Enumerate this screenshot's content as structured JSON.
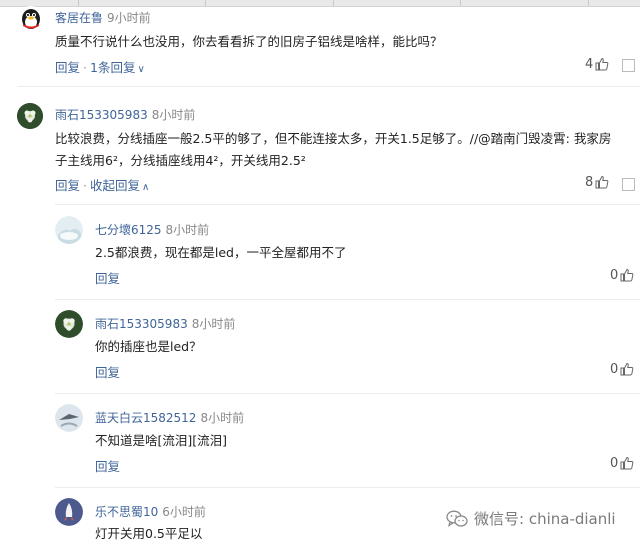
{
  "comments": [
    {
      "user": "客居在鲁",
      "time": "9小时前",
      "text": "质量不行说什么也没用，你去看看拆了的旧房子铝线是啥样，能比吗？",
      "reply": "回复",
      "thread": "1条回复",
      "likes": "4"
    },
    {
      "user": "雨石153305983",
      "time": "8小时前",
      "text_line1": "比较浪费，分线插座一般2.5平的够了，但不能连接太多，开关1.5足够了。//@踏南门毁凌霄: 我家房",
      "text_line2": "子主线用6²，分线插座线用4²，开关线用2.5²",
      "reply": "回复",
      "thread": "收起回复",
      "likes": "8"
    }
  ],
  "replies": [
    {
      "user": "七分壞6125",
      "time": "8小时前",
      "text": "2.5都浪费，现在都是led，一平全屋都用不了",
      "reply": "回复",
      "likes": "0"
    },
    {
      "user": "雨石153305983",
      "time": "8小时前",
      "text": "你的插座也是led？",
      "reply": "回复",
      "likes": "0"
    },
    {
      "user": "蓝天白云1582512",
      "time": "8小时前",
      "text": "不知道是啥[流泪][流泪]",
      "reply": "回复",
      "likes": "0"
    },
    {
      "user": "乐不思蜀10",
      "time": "6小时前",
      "text": "灯开关用0.5平足以"
    }
  ],
  "watermark": "微信号: china-dianli",
  "icons": {
    "like": "thumbs-up-icon",
    "more": "more-icon",
    "wechat": "wechat-icon"
  },
  "colors": {
    "link": "#406599",
    "meta": "#888888"
  }
}
